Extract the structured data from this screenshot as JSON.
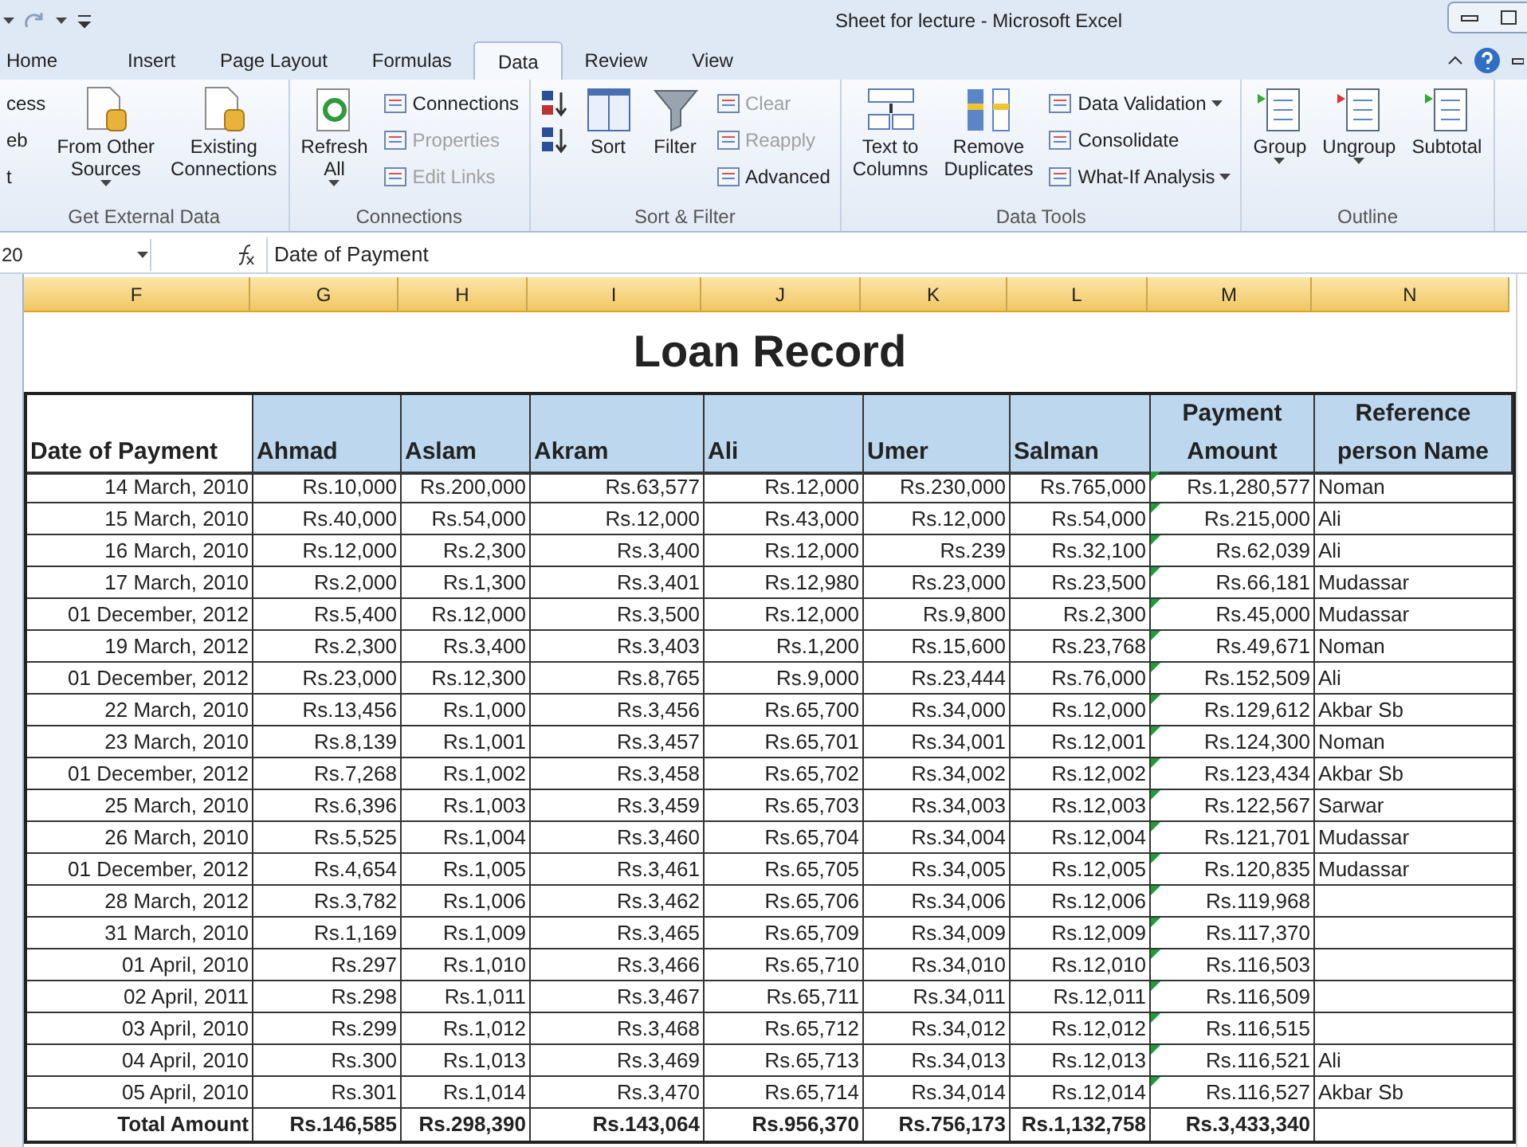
{
  "title_bar": {
    "title": "Sheet for lecture - Microsoft Excel"
  },
  "tabs": [
    {
      "label": "Home",
      "selected": false
    },
    {
      "label": "Insert",
      "selected": false
    },
    {
      "label": "Page Layout",
      "selected": false
    },
    {
      "label": "Formulas",
      "selected": false
    },
    {
      "label": "Data",
      "selected": true
    },
    {
      "label": "Review",
      "selected": false
    },
    {
      "label": "View",
      "selected": false
    }
  ],
  "ribbon": {
    "groups": [
      {
        "label": "Get External Data",
        "columns": [
          [
            {
              "kind": "cut",
              "lines": [
                "cess"
              ],
              "disabled": false,
              "dropdown": false
            },
            {
              "kind": "cut",
              "lines": [
                "eb"
              ],
              "disabled": false,
              "dropdown": false
            },
            {
              "kind": "cut",
              "lines": [
                "t"
              ],
              "disabled": false,
              "dropdown": false
            }
          ],
          [
            {
              "kind": "large",
              "lines": [
                "From Other",
                "Sources"
              ],
              "disabled": false,
              "dropdown": true
            }
          ],
          [
            {
              "kind": "large",
              "lines": [
                "Existing",
                "Connections"
              ],
              "disabled": false,
              "dropdown": false
            }
          ]
        ]
      },
      {
        "label": "Connections",
        "columns": [
          [
            {
              "kind": "large",
              "lines": [
                "Refresh",
                "All"
              ],
              "disabled": false,
              "dropdown": true
            }
          ],
          [
            {
              "kind": "small",
              "lines": [
                "Connections"
              ],
              "disabled": false,
              "dropdown": false
            },
            {
              "kind": "small",
              "lines": [
                "Properties"
              ],
              "disabled": true,
              "dropdown": false
            },
            {
              "kind": "small",
              "lines": [
                "Edit Links"
              ],
              "disabled": true,
              "dropdown": false
            }
          ]
        ]
      },
      {
        "label": "Sort & Filter",
        "columns": [
          [
            {
              "kind": "icon",
              "disabled": false,
              "dropdown": false
            },
            {
              "kind": "icon",
              "disabled": false,
              "dropdown": false
            }
          ],
          [
            {
              "kind": "large",
              "lines": [
                "Sort"
              ],
              "disabled": false,
              "dropdown": false
            }
          ],
          [
            {
              "kind": "large",
              "lines": [
                "Filter"
              ],
              "disabled": false,
              "dropdown": false
            }
          ],
          [
            {
              "kind": "small",
              "lines": [
                "Clear"
              ],
              "disabled": true,
              "dropdown": false
            },
            {
              "kind": "small",
              "lines": [
                "Reapply"
              ],
              "disabled": true,
              "dropdown": false
            },
            {
              "kind": "small",
              "lines": [
                "Advanced"
              ],
              "disabled": false,
              "dropdown": false
            }
          ]
        ]
      },
      {
        "label": "Data Tools",
        "columns": [
          [
            {
              "kind": "large",
              "lines": [
                "Text to",
                "Columns"
              ],
              "disabled": false,
              "dropdown": false
            }
          ],
          [
            {
              "kind": "large",
              "lines": [
                "Remove",
                "Duplicates"
              ],
              "disabled": false,
              "dropdown": false
            }
          ],
          [
            {
              "kind": "small",
              "lines": [
                "Data Validation"
              ],
              "disabled": false,
              "dropdown": true
            },
            {
              "kind": "small",
              "lines": [
                "Consolidate"
              ],
              "disabled": false,
              "dropdown": false
            },
            {
              "kind": "small",
              "lines": [
                "What-If Analysis"
              ],
              "disabled": false,
              "dropdown": true
            }
          ]
        ]
      },
      {
        "label": "Outline",
        "columns": [
          [
            {
              "kind": "large",
              "lines": [
                "Group"
              ],
              "disabled": false,
              "dropdown": true
            }
          ],
          [
            {
              "kind": "large",
              "lines": [
                "Ungroup"
              ],
              "disabled": false,
              "dropdown": true
            }
          ],
          [
            {
              "kind": "large",
              "lines": [
                "Subtotal"
              ],
              "disabled": false,
              "dropdown": false
            }
          ]
        ]
      }
    ]
  },
  "formula_bar": {
    "name_box": "20",
    "formula": "Date of Payment"
  },
  "sheet": {
    "column_headers": [
      "F",
      "G",
      "H",
      "I",
      "J",
      "K",
      "L",
      "M",
      "N"
    ],
    "title": "Loan Record",
    "columns": [
      {
        "lines": [
          "Date of Payment"
        ],
        "shaded": false
      },
      {
        "lines": [
          "Ahmad"
        ],
        "shaded": true
      },
      {
        "lines": [
          "Aslam"
        ],
        "shaded": true
      },
      {
        "lines": [
          "Akram"
        ],
        "shaded": true
      },
      {
        "lines": [
          "Ali"
        ],
        "shaded": true
      },
      {
        "lines": [
          "Umer"
        ],
        "shaded": true
      },
      {
        "lines": [
          "Salman"
        ],
        "shaded": true
      },
      {
        "lines": [
          "Payment",
          "Amount"
        ],
        "shaded": true
      },
      {
        "lines": [
          "Reference",
          "person Name"
        ],
        "shaded": true
      }
    ],
    "rows": [
      {
        "date": "14 March, 2010",
        "amounts": [
          "Rs.10,000",
          "Rs.200,000",
          "Rs.63,577",
          "Rs.12,000",
          "Rs.230,000",
          "Rs.765,000"
        ],
        "payment": "Rs.1,280,577",
        "reference": "Noman",
        "warning": true
      },
      {
        "date": "15 March, 2010",
        "amounts": [
          "Rs.40,000",
          "Rs.54,000",
          "Rs.12,000",
          "Rs.43,000",
          "Rs.12,000",
          "Rs.54,000"
        ],
        "payment": "Rs.215,000",
        "reference": "Ali",
        "warning": true
      },
      {
        "date": "16 March, 2010",
        "amounts": [
          "Rs.12,000",
          "Rs.2,300",
          "Rs.3,400",
          "Rs.12,000",
          "Rs.239",
          "Rs.32,100"
        ],
        "payment": "Rs.62,039",
        "reference": "Ali",
        "warning": true
      },
      {
        "date": "17 March, 2010",
        "amounts": [
          "Rs.2,000",
          "Rs.1,300",
          "Rs.3,401",
          "Rs.12,980",
          "Rs.23,000",
          "Rs.23,500"
        ],
        "payment": "Rs.66,181",
        "reference": "Mudassar",
        "warning": true
      },
      {
        "date": "01 December, 2012",
        "amounts": [
          "Rs.5,400",
          "Rs.12,000",
          "Rs.3,500",
          "Rs.12,000",
          "Rs.9,800",
          "Rs.2,300"
        ],
        "payment": "Rs.45,000",
        "reference": "Mudassar",
        "warning": true
      },
      {
        "date": "19 March, 2012",
        "amounts": [
          "Rs.2,300",
          "Rs.3,400",
          "Rs.3,403",
          "Rs.1,200",
          "Rs.15,600",
          "Rs.23,768"
        ],
        "payment": "Rs.49,671",
        "reference": "Noman",
        "warning": true
      },
      {
        "date": "01 December, 2012",
        "amounts": [
          "Rs.23,000",
          "Rs.12,300",
          "Rs.8,765",
          "Rs.9,000",
          "Rs.23,444",
          "Rs.76,000"
        ],
        "payment": "Rs.152,509",
        "reference": "Ali",
        "warning": true
      },
      {
        "date": "22 March, 2010",
        "amounts": [
          "Rs.13,456",
          "Rs.1,000",
          "Rs.3,456",
          "Rs.65,700",
          "Rs.34,000",
          "Rs.12,000"
        ],
        "payment": "Rs.129,612",
        "reference": "Akbar Sb",
        "warning": true
      },
      {
        "date": "23 March, 2010",
        "amounts": [
          "Rs.8,139",
          "Rs.1,001",
          "Rs.3,457",
          "Rs.65,701",
          "Rs.34,001",
          "Rs.12,001"
        ],
        "payment": "Rs.124,300",
        "reference": "Noman",
        "warning": true
      },
      {
        "date": "01 December, 2012",
        "amounts": [
          "Rs.7,268",
          "Rs.1,002",
          "Rs.3,458",
          "Rs.65,702",
          "Rs.34,002",
          "Rs.12,002"
        ],
        "payment": "Rs.123,434",
        "reference": "Akbar Sb",
        "warning": true
      },
      {
        "date": "25 March, 2010",
        "amounts": [
          "Rs.6,396",
          "Rs.1,003",
          "Rs.3,459",
          "Rs.65,703",
          "Rs.34,003",
          "Rs.12,003"
        ],
        "payment": "Rs.122,567",
        "reference": "Sarwar",
        "warning": true
      },
      {
        "date": "26 March, 2010",
        "amounts": [
          "Rs.5,525",
          "Rs.1,004",
          "Rs.3,460",
          "Rs.65,704",
          "Rs.34,004",
          "Rs.12,004"
        ],
        "payment": "Rs.121,701",
        "reference": "Mudassar",
        "warning": true
      },
      {
        "date": "01 December, 2012",
        "amounts": [
          "Rs.4,654",
          "Rs.1,005",
          "Rs.3,461",
          "Rs.65,705",
          "Rs.34,005",
          "Rs.12,005"
        ],
        "payment": "Rs.120,835",
        "reference": "Mudassar",
        "warning": true
      },
      {
        "date": "28 March, 2012",
        "amounts": [
          "Rs.3,782",
          "Rs.1,006",
          "Rs.3,462",
          "Rs.65,706",
          "Rs.34,006",
          "Rs.12,006"
        ],
        "payment": "Rs.119,968",
        "warning": true
      },
      {
        "date": "31 March, 2010",
        "amounts": [
          "Rs.1,169",
          "Rs.1,009",
          "Rs.3,465",
          "Rs.65,709",
          "Rs.34,009",
          "Rs.12,009"
        ],
        "payment": "Rs.117,370",
        "warning": true
      },
      {
        "date": "01 April, 2010",
        "amounts": [
          "Rs.297",
          "Rs.1,010",
          "Rs.3,466",
          "Rs.65,710",
          "Rs.34,010",
          "Rs.12,010"
        ],
        "payment": "Rs.116,503",
        "warning": true
      },
      {
        "date": "02 April, 2011",
        "amounts": [
          "Rs.298",
          "Rs.1,011",
          "Rs.3,467",
          "Rs.65,711",
          "Rs.34,011",
          "Rs.12,011"
        ],
        "payment": "Rs.116,509",
        "warning": true
      },
      {
        "date": "03 April, 2010",
        "amounts": [
          "Rs.299",
          "Rs.1,012",
          "Rs.3,468",
          "Rs.65,712",
          "Rs.34,012",
          "Rs.12,012"
        ],
        "payment": "Rs.116,515",
        "warning": true
      },
      {
        "date": "04 April, 2010",
        "amounts": [
          "Rs.300",
          "Rs.1,013",
          "Rs.3,469",
          "Rs.65,713",
          "Rs.34,013",
          "Rs.12,013"
        ],
        "payment": "Rs.116,521",
        "reference": "Ali",
        "warning": true
      },
      {
        "date": "05 April, 2010",
        "amounts": [
          "Rs.301",
          "Rs.1,014",
          "Rs.3,470",
          "Rs.65,714",
          "Rs.34,014",
          "Rs.12,014"
        ],
        "payment": "Rs.116,527",
        "reference": "Akbar Sb",
        "warning": true
      }
    ],
    "total": {
      "label": "Total Amount",
      "amounts": [
        "Rs.146,585",
        "Rs.298,390",
        "Rs.143,064",
        "Rs.956,370",
        "Rs.756,173",
        "Rs.1,132,758"
      ],
      "payment": "Rs.3,433,340"
    }
  }
}
